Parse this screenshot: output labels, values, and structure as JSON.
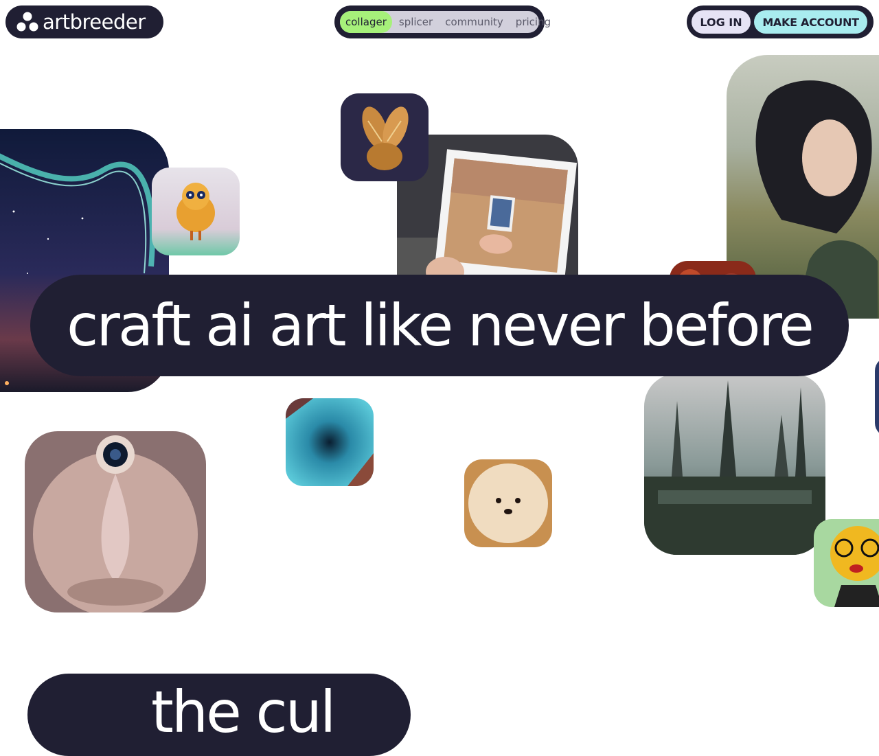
{
  "brand": {
    "name": "artbreeder",
    "logo_icon": "three-circles-logo-icon"
  },
  "nav": {
    "items": [
      {
        "label": "collager",
        "active": true
      },
      {
        "label": "splicer",
        "active": false
      },
      {
        "label": "community",
        "active": false
      },
      {
        "label": "pricing",
        "active": false
      }
    ]
  },
  "auth": {
    "login_label": "LOG IN",
    "signup_label": "MAKE ACCOUNT"
  },
  "hero": {
    "headline": "craft ai art like never before"
  },
  "next_section": {
    "partial_heading": "the cul"
  },
  "colors": {
    "dark": "#201f33",
    "nav_active": "#a6f07a",
    "login_bg": "#e6e3f5",
    "signup_bg": "#a9ecef"
  }
}
